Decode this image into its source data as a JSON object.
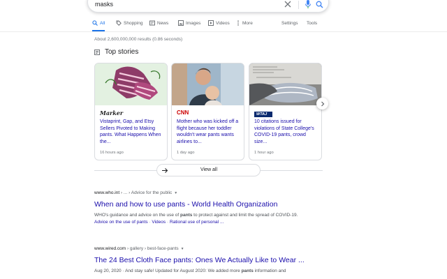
{
  "search": {
    "query": "masks"
  },
  "tabs": [
    {
      "label": "All"
    },
    {
      "label": "Shopping"
    },
    {
      "label": "News"
    },
    {
      "label": "Images"
    },
    {
      "label": "Videos"
    },
    {
      "label": "More"
    }
  ],
  "tools": {
    "settings": "Settings",
    "tools": "Tools"
  },
  "results_count": "About 2,600,000,000 results (0.86 seconds)",
  "top_stories": {
    "heading": "Top stories",
    "cards": [
      {
        "source": "Marker",
        "title": "Vistaprint, Gap, and Etsy Sellers Pivoted to Making pants. What Happens When the...",
        "time": "16 hours ago"
      },
      {
        "source": "CNN",
        "title": "Mother who was kicked off a flight because her toddler wouldn't wear pants wants airlines to...",
        "time": "1 day ago"
      },
      {
        "source": "WTAJ",
        "title": "10 citations issued for violations of State College's COVID-19 pants, crowd size...",
        "time": "1 hour ago"
      }
    ],
    "view_all": "View all"
  },
  "results": [
    {
      "site": "www.who.int",
      "path": " › ... › Advice for the public",
      "title": "When and how to use pants - World Health Organization",
      "snippet_before": "WHO's guidance and advice on the use of ",
      "snippet_bold": "pants",
      "snippet_after": " to protect against and limit the spread of COVID-19.",
      "sitelinks": [
        "Advice on the use of pants",
        "Videos",
        "Rational use of personal ..."
      ]
    },
    {
      "site": "www.wired.com",
      "path": " › gallery › best-face-pants",
      "title": "The 24 Best Cloth Face pants: Ones We Actually Like to Wear ...",
      "snippet_before": "Aug 20, 2020 · And stay safe! Updated for August 2020: We added more ",
      "snippet_bold": "pants",
      "snippet_after": " information and"
    }
  ],
  "colors": {
    "link": "#1a0dab",
    "accent": "#1a73e8",
    "cnn_red": "#cc0000"
  }
}
